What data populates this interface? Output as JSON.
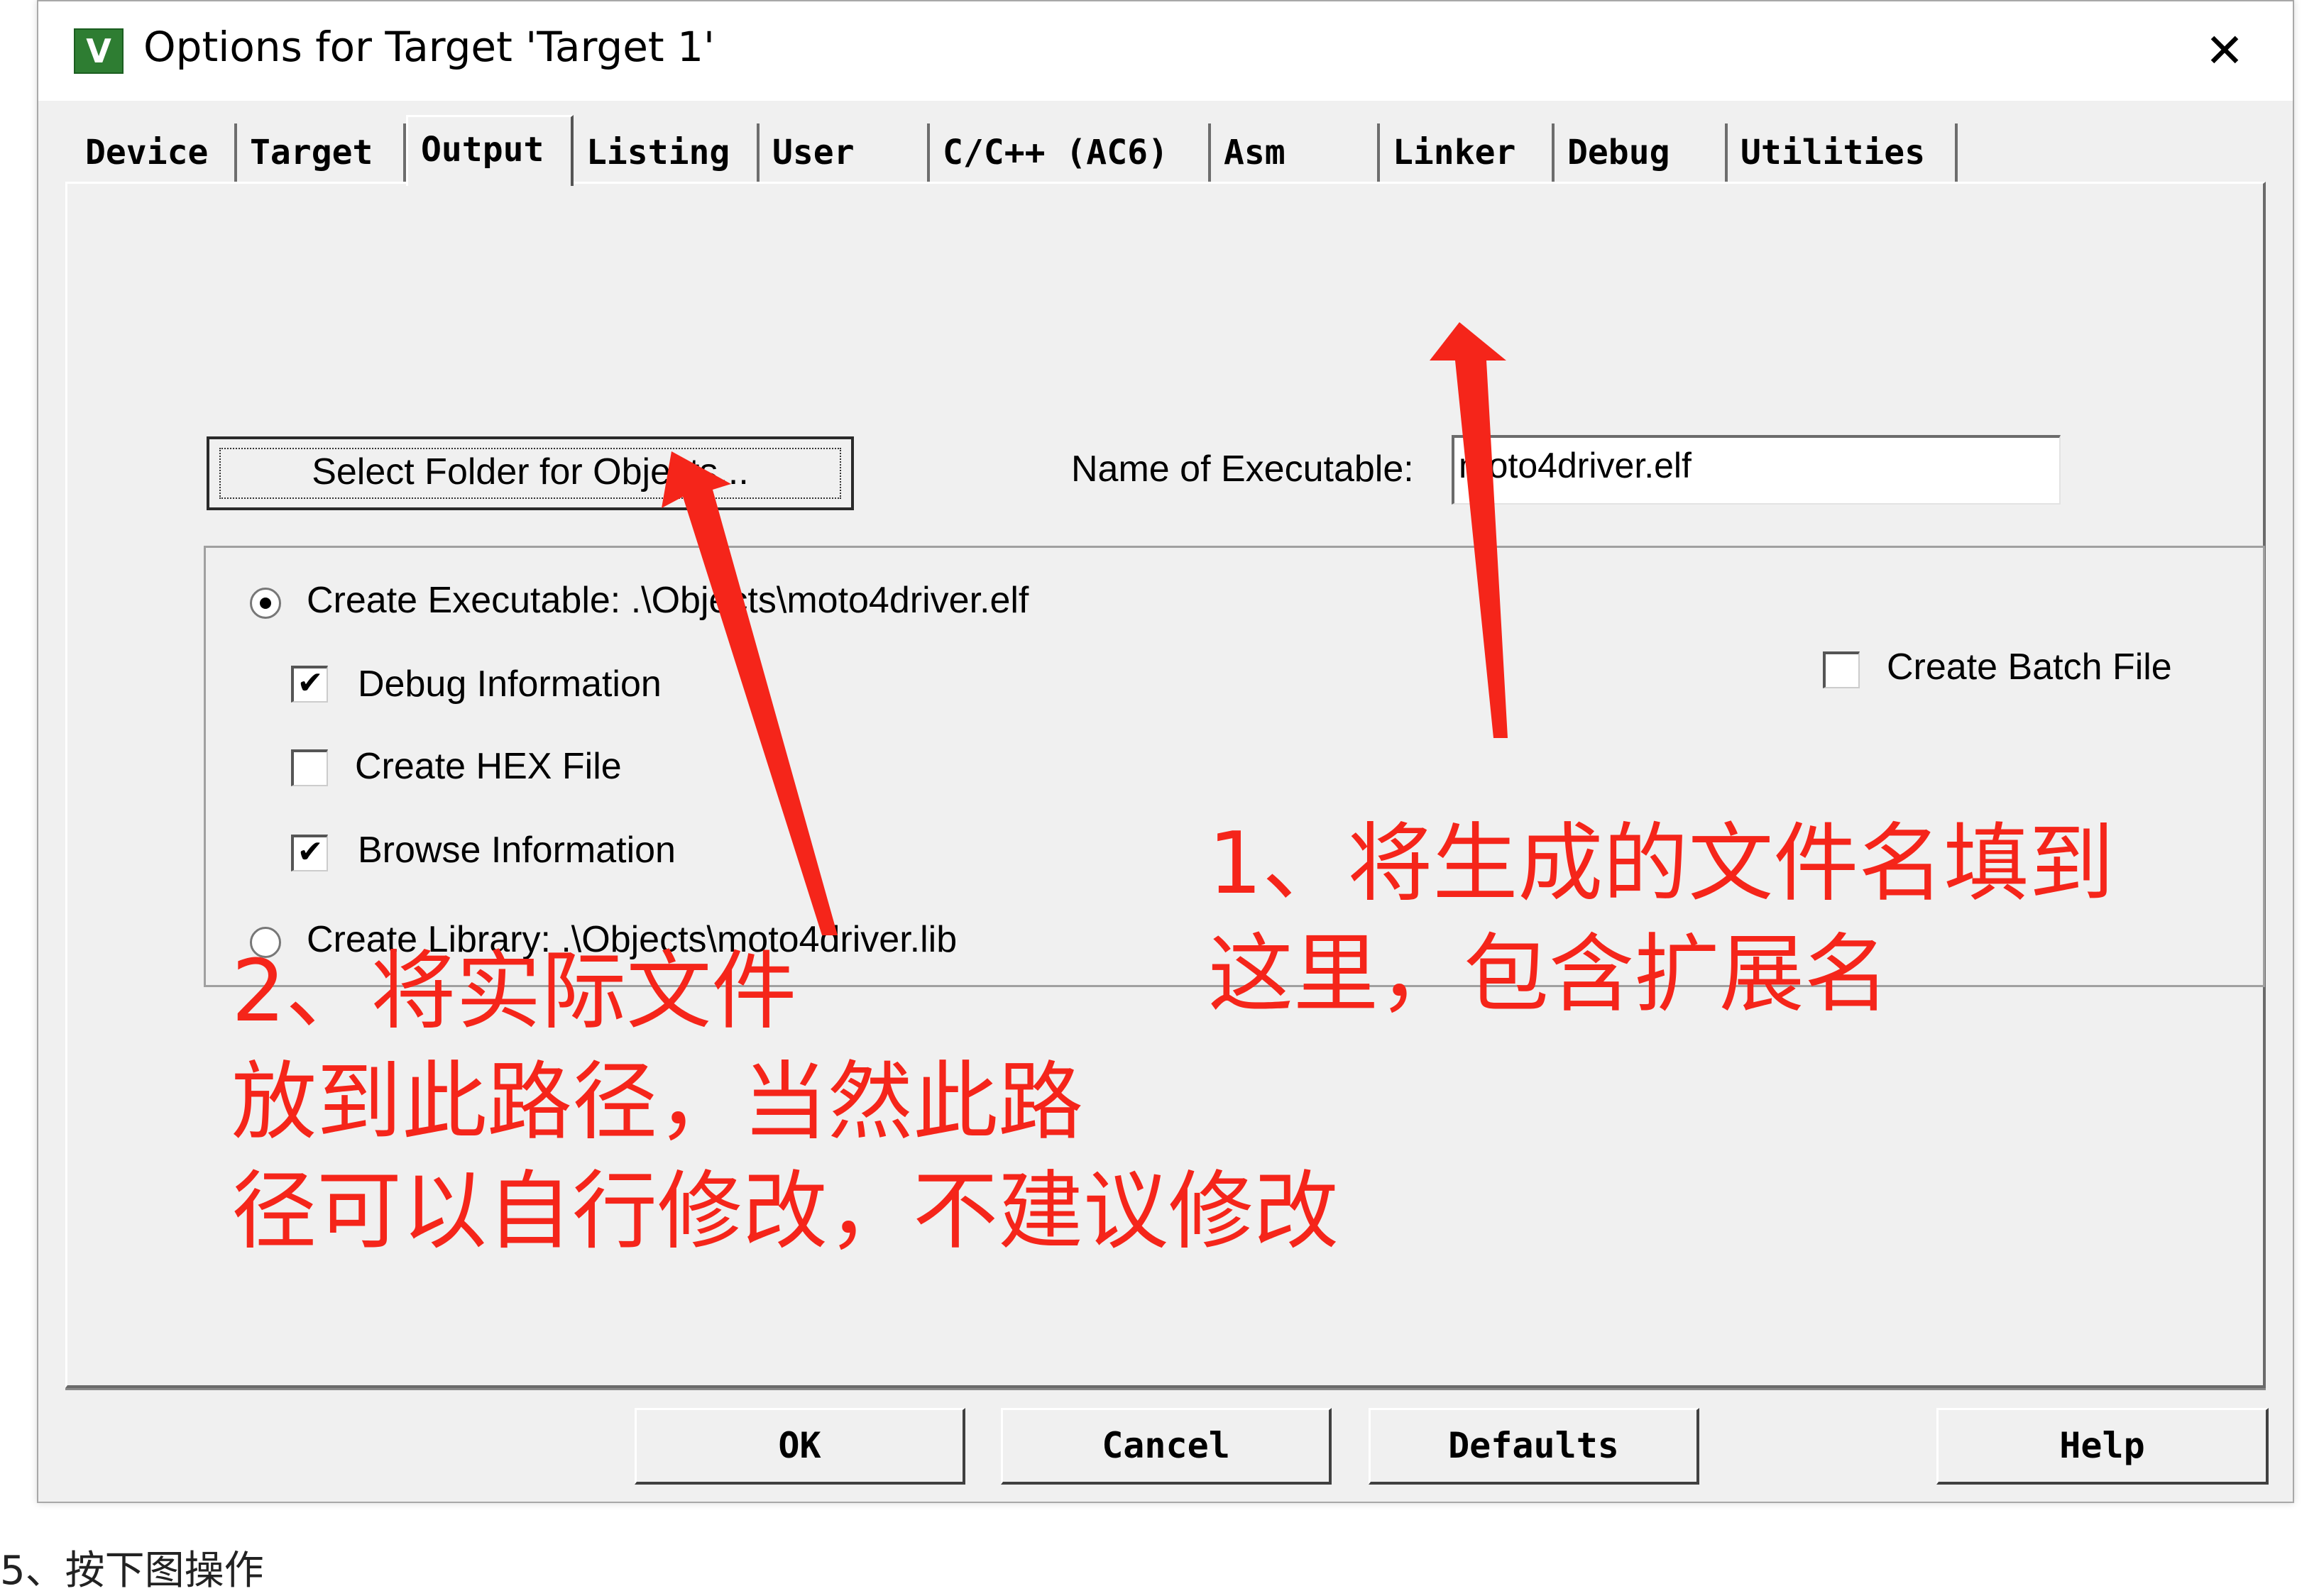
{
  "window": {
    "title": "Options for Target 'Target 1'",
    "app_icon_glyph": "V",
    "close_glyph": "✕"
  },
  "tabs": [
    {
      "label": "Device"
    },
    {
      "label": "Target"
    },
    {
      "label": "Output",
      "active": true
    },
    {
      "label": "Listing"
    },
    {
      "label": "User"
    },
    {
      "label": "C/C++ (AC6)"
    },
    {
      "label": "Asm"
    },
    {
      "label": "Linker"
    },
    {
      "label": "Debug"
    },
    {
      "label": "Utilities"
    }
  ],
  "output": {
    "select_folder_label": "Select Folder for Objects...",
    "exe_name_label": "Name of Executable:",
    "exe_name_value": "moto4driver.elf",
    "create_executable_label": "Create Executable:  .\\Objects\\moto4driver.elf",
    "create_executable_selected": true,
    "debug_info_label": "Debug Information",
    "debug_info_checked": true,
    "create_hex_label": "Create HEX File",
    "create_hex_checked": false,
    "browse_info_label": "Browse Information",
    "browse_info_checked": true,
    "create_library_label": "Create Library:  .\\Objects\\moto4driver.lib",
    "create_library_selected": false,
    "create_batch_label": "Create Batch File",
    "create_batch_checked": false,
    "check_glyph": "✔"
  },
  "footer": {
    "ok": "OK",
    "cancel": "Cancel",
    "defaults": "Defaults",
    "help": "Help"
  },
  "annotations": {
    "note1_line1": "1、将生成的文件名填到",
    "note1_line2": "这里，包含扩展名",
    "note2_line1": "2、将实际文件",
    "note2_line2": "放到此路径，当然此路",
    "note2_line3": "径可以自行修改，不建议修改",
    "color": "#f5251a"
  },
  "caption": "5、按下图操作"
}
